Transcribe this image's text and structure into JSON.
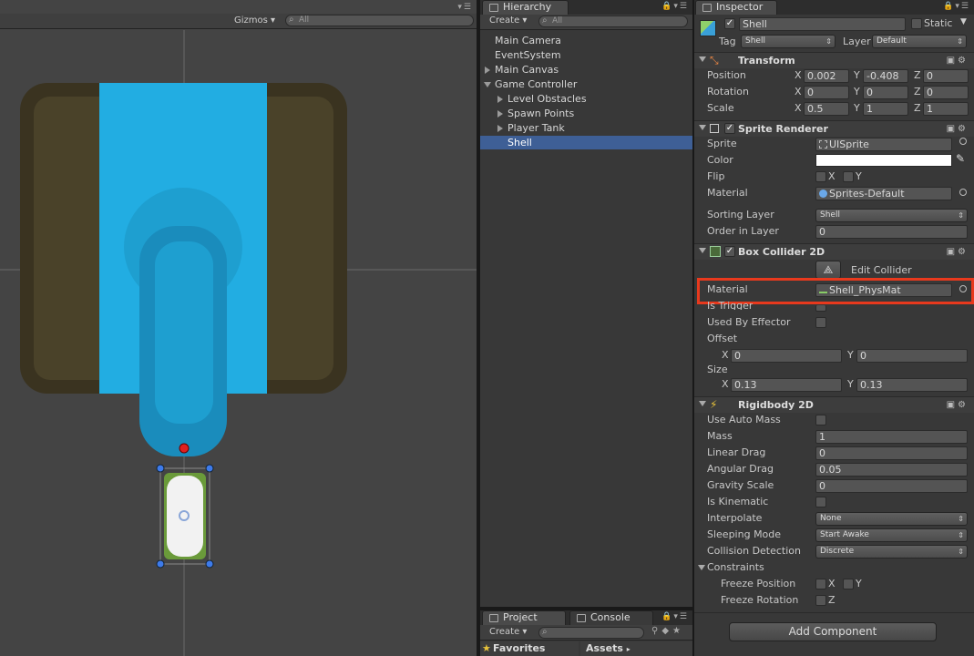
{
  "scene": {
    "gizmos_label": "Gizmos",
    "search_placeholder": "All"
  },
  "hierarchy": {
    "tab": "Hierarchy",
    "create": "Create",
    "search_placeholder": "All",
    "items": [
      {
        "label": "Main Camera"
      },
      {
        "label": "EventSystem"
      },
      {
        "label": "Main Canvas"
      },
      {
        "label": "Game Controller"
      },
      {
        "label": "Level Obstacles"
      },
      {
        "label": "Spawn Points"
      },
      {
        "label": "Player Tank"
      },
      {
        "label": "Shell"
      }
    ]
  },
  "project": {
    "tab_project": "Project",
    "tab_console": "Console",
    "create": "Create",
    "favorites": "Favorites",
    "assets": "Assets"
  },
  "inspector": {
    "tab": "Inspector",
    "object_name": "Shell",
    "static_label": "Static",
    "tag_label": "Tag",
    "tag_value": "Shell",
    "layer_label": "Layer",
    "layer_value": "Default",
    "transform": {
      "title": "Transform",
      "position_label": "Position",
      "rotation_label": "Rotation",
      "scale_label": "Scale",
      "position": {
        "x": "0.002",
        "y": "-0.408",
        "z": "0"
      },
      "rotation": {
        "x": "0",
        "y": "0",
        "z": "0"
      },
      "scale": {
        "x": "0.5",
        "y": "1",
        "z": "1"
      }
    },
    "sprite_renderer": {
      "title": "Sprite Renderer",
      "sprite_label": "Sprite",
      "sprite_value": "UISprite",
      "color_label": "Color",
      "color_value": "#ffffff",
      "flip_label": "Flip",
      "flip_x": "X",
      "flip_y": "Y",
      "material_label": "Material",
      "material_value": "Sprites-Default",
      "sorting_layer_label": "Sorting Layer",
      "sorting_layer_value": "Shell",
      "order_label": "Order in Layer",
      "order_value": "0"
    },
    "box_collider": {
      "title": "Box Collider 2D",
      "edit_collider": "Edit Collider",
      "material_label": "Material",
      "material_value": "Shell_PhysMat",
      "is_trigger_label": "Is Trigger",
      "used_by_effector_label": "Used By Effector",
      "offset_label": "Offset",
      "offset": {
        "x": "0",
        "y": "0"
      },
      "size_label": "Size",
      "size": {
        "x": "0.13",
        "y": "0.13"
      }
    },
    "rigidbody": {
      "title": "Rigidbody 2D",
      "use_auto_mass_label": "Use Auto Mass",
      "mass_label": "Mass",
      "mass_value": "1",
      "linear_drag_label": "Linear Drag",
      "linear_drag_value": "0",
      "angular_drag_label": "Angular Drag",
      "angular_drag_value": "0.05",
      "gravity_scale_label": "Gravity Scale",
      "gravity_scale_value": "0",
      "is_kinematic_label": "Is Kinematic",
      "interpolate_label": "Interpolate",
      "interpolate_value": "None",
      "sleeping_mode_label": "Sleeping Mode",
      "sleeping_mode_value": "Start Awake",
      "collision_detection_label": "Collision Detection",
      "collision_detection_value": "Discrete",
      "constraints_label": "Constraints",
      "freeze_position_label": "Freeze Position",
      "freeze_rotation_label": "Freeze Rotation",
      "x_label": "X",
      "y_label": "Y",
      "z_label": "Z"
    },
    "add_component": "Add Component"
  },
  "colors": {
    "highlight": "#e8391d",
    "selection": "#3e5f96",
    "tank_blue": "#22ade2"
  }
}
